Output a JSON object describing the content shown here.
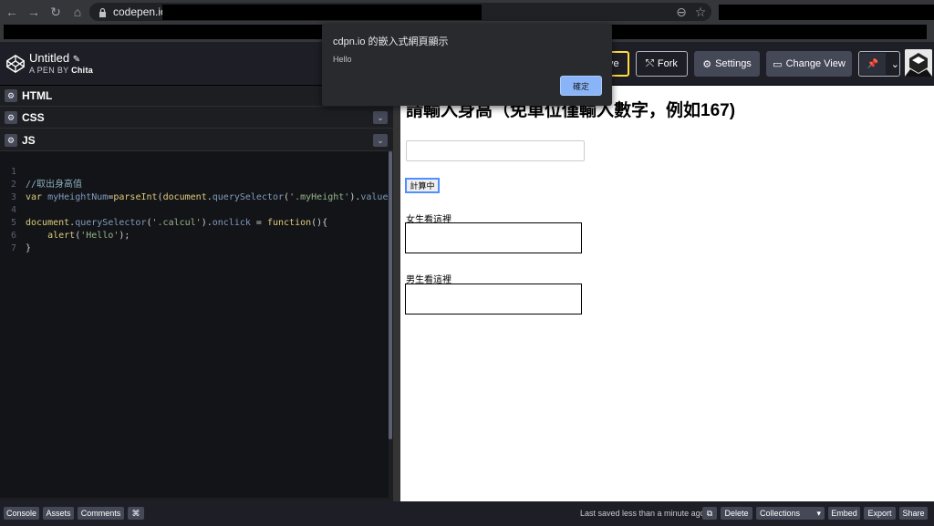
{
  "browser": {
    "url": "codepen.io/",
    "back_glyph": "←",
    "forward_glyph": "→",
    "reload_glyph": "↻",
    "home_glyph": "⌂",
    "lock_glyph": "🔒",
    "zoom_glyph": "⊖",
    "star_glyph": "☆"
  },
  "header": {
    "pen_title": "Untitled",
    "edit_glyph": "✎",
    "pen_by_prefix": "A PEN BY",
    "author": "Chita",
    "save_label_partial": "ve",
    "fork_label": "Fork",
    "fork_glyph": "⤲",
    "settings_label": "Settings",
    "settings_glyph": "⚙",
    "change_view_label": "Change View",
    "change_view_glyph": "▭",
    "pin_glyph": "📌",
    "dropdown_glyph": "⌄"
  },
  "editors": {
    "gear_glyph": "⚙",
    "chevron_glyph": "⌄",
    "html_label": "HTML",
    "css_label": "CSS",
    "js_label": "JS"
  },
  "code": {
    "line_numbers": [
      "1",
      "2",
      "3",
      "4",
      "5",
      "6",
      "7"
    ],
    "l1_comment": "//取出身高值",
    "l2_kw": "var",
    "l2_var": "myHeightNum",
    "l2_eq": "=",
    "l2_fn": "parseInt",
    "l2_p1": "(",
    "l2_doc": "document",
    "l2_dot": ".",
    "l2_qs": "querySelector",
    "l2_p2": "(",
    "l2_str": "'.myHeight'",
    "l2_p3": ").",
    "l2_val": "value",
    "l2_p4": ")",
    "l4_doc": "document",
    "l4_dot": ".",
    "l4_qs": "querySelector",
    "l4_p1": "(",
    "l4_str": "'.calcul'",
    "l4_p2": ").",
    "l4_on": "onclick",
    "l4_eq": " = ",
    "l4_fn": "function",
    "l4_p3": "(){",
    "l5_indent": "    ",
    "l5_fn": "alert",
    "l5_p1": "(",
    "l5_str": "'Hello'",
    "l5_p2": ");",
    "l6": "}"
  },
  "result": {
    "title": "請輸入身高（免單位僅輸入數字，例如167)",
    "button_label": "計算中",
    "female_label": "女生看這裡",
    "male_label": "男生看這裡"
  },
  "dialog": {
    "title": "cdpn.io 的嵌入式網頁顯示",
    "message": "Hello",
    "ok_label": "確定"
  },
  "footer": {
    "console": "Console",
    "assets": "Assets",
    "comments": "Comments",
    "shortcut_glyph": "⌘",
    "last_saved": "Last saved less than a minute ago",
    "external_glyph": "⧉",
    "delete": "Delete",
    "collections": "Collections",
    "collections_glyph": "▾",
    "embed": "Embed",
    "export": "Export",
    "share": "Share"
  },
  "colors": {
    "accent_yellow": "#ffdd40",
    "dialog_button": "#8ab4f8",
    "editor_bg": "#131417"
  }
}
